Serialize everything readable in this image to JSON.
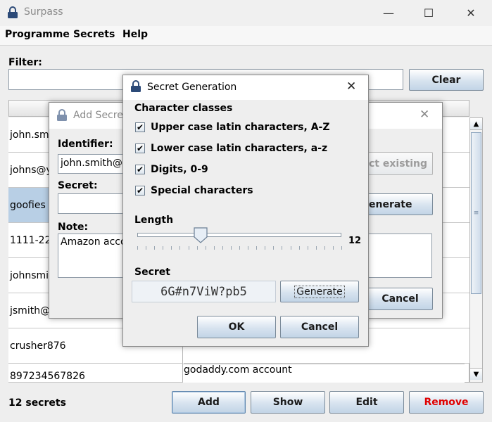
{
  "app": {
    "title": "Surpass",
    "menus": [
      "Programme",
      "Secrets",
      "Help"
    ],
    "filter_label": "Filter:",
    "filter_value": "",
    "clear_label": "Clear",
    "table_rows": [
      {
        "id": "john.smith",
        "selected": false
      },
      {
        "id": "johns@y",
        "selected": false
      },
      {
        "id": "goofies",
        "selected": true
      },
      {
        "id": "1111-222",
        "selected": false
      },
      {
        "id": "johnsmith",
        "selected": false
      },
      {
        "id": "jsmith@y",
        "selected": false
      },
      {
        "id": "crusher876",
        "selected": false
      },
      {
        "id": "897234567826",
        "selected": false
      }
    ],
    "last_row_note": "godaddy.com account",
    "status": "12 secrets",
    "buttons": {
      "add": "Add",
      "show": "Show",
      "edit": "Edit",
      "remove": "Remove"
    },
    "remove_color": "#e00000"
  },
  "add_dialog": {
    "title": "Add Secret",
    "identifier_label": "Identifier:",
    "identifier_value": "john.smith@g",
    "select_existing_label": "ct existing",
    "secret_label": "Secret:",
    "secret_value": "",
    "generate_label": "enerate",
    "note_label": "Note:",
    "note_value": "Amazon acco",
    "cancel_label": "Cancel"
  },
  "gen_dialog": {
    "title": "Secret Generation",
    "classes_label": "Character classes",
    "classes": [
      {
        "label": "Upper case latin characters, A-Z",
        "checked": true
      },
      {
        "label": "Lower case latin characters, a-z",
        "checked": true
      },
      {
        "label": "Digits, 0-9",
        "checked": true
      },
      {
        "label": "Special characters",
        "checked": true
      }
    ],
    "length_label": "Length",
    "length_value": "12",
    "length_slider_fraction": 0.31,
    "secret_label": "Secret",
    "secret_value": "6G#n7ViW?pb5",
    "generate_label": "Generate",
    "ok_label": "OK",
    "cancel_label": "Cancel"
  }
}
